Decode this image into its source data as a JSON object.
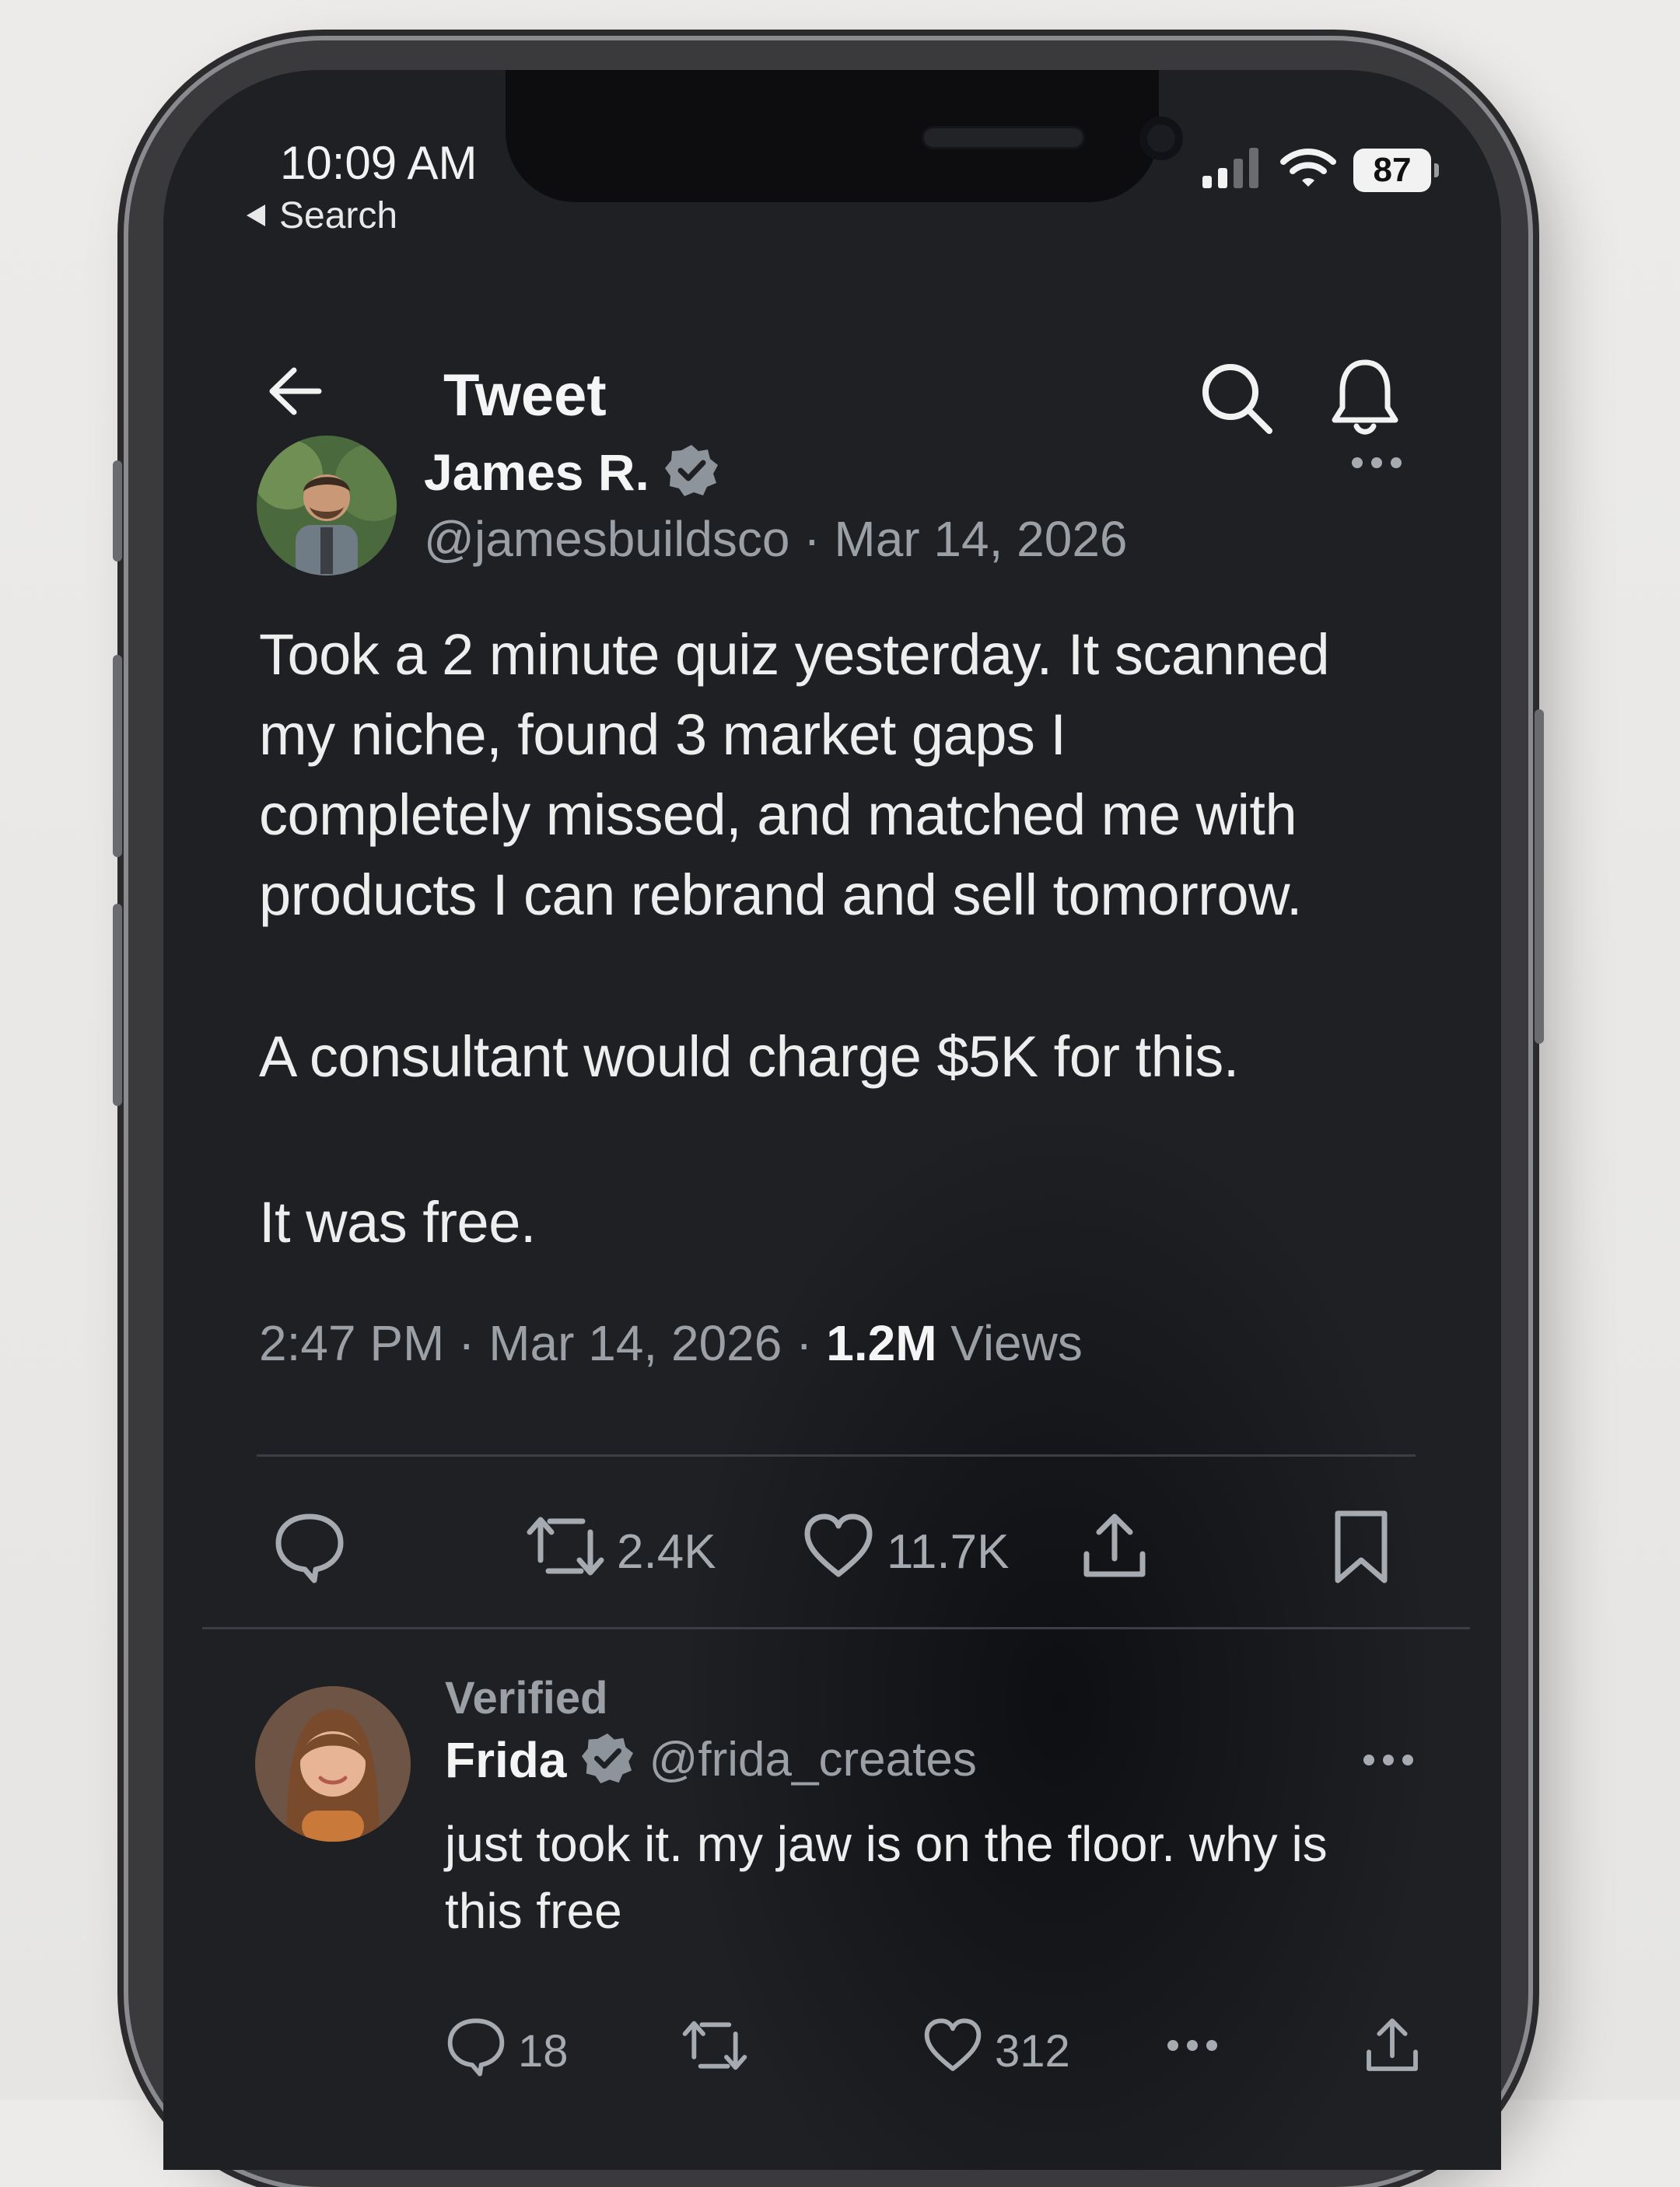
{
  "status_bar": {
    "time": "10:09 AM",
    "back_label": "Search",
    "battery": "87"
  },
  "header": {
    "title": "Tweet",
    "back_icon": "arrow-left-icon",
    "search_icon": "search-icon",
    "bell_icon": "bell-icon"
  },
  "tweet": {
    "author_name": "James R.",
    "handle": "@jamesbuildsco",
    "date": "Mar 14, 2026",
    "body": [
      "Took a 2 minute quiz yesterday. It scanned",
      "my niche, found 3 market gaps I",
      "completely missed, and matched me with",
      "products I can rebrand and sell tomorrow.",
      "A consultant would charge $5K for this.",
      "It was free."
    ],
    "meta_time": "2:47 PM",
    "meta_date": "Mar 14, 2026",
    "views_count": "1.2M",
    "views_label": "Views",
    "retweets": "2.4K",
    "likes": "11.7K"
  },
  "reply": {
    "label": "Verified",
    "author_name": "Frida",
    "handle": "@frida_creates",
    "body": [
      "just took it. my jaw is on the floor. why is",
      "this free"
    ],
    "replies": "18",
    "likes": "312"
  },
  "colors": {
    "background": "#1e2024",
    "text": "#e9eaec",
    "muted": "#9aa0a6",
    "verified": "#8d949c"
  }
}
